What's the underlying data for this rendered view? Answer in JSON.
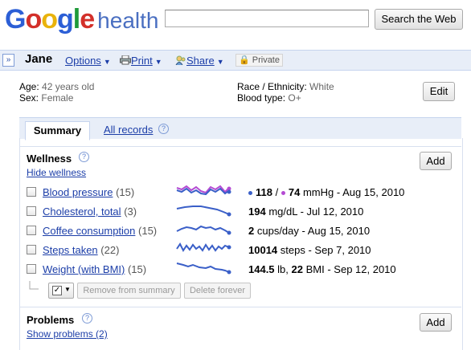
{
  "header": {
    "logo_text": "Google",
    "product": "health",
    "search_placeholder": "",
    "search_button": "Search the Web"
  },
  "profile": {
    "collapse_glyph": "»",
    "name": "Jane",
    "options": "Options",
    "print": "Print",
    "share": "Share",
    "private": "Private",
    "age_label": "Age:",
    "age_value": "42 years old",
    "sex_label": "Sex:",
    "sex_value": "Female",
    "race_label": "Race / Ethnicity:",
    "race_value": "White",
    "blood_label": "Blood type:",
    "blood_value": "O+",
    "edit": "Edit"
  },
  "tabs": {
    "summary": "Summary",
    "all_records": "All records"
  },
  "wellness": {
    "title": "Wellness",
    "hide": "Hide wellness",
    "add": "Add",
    "rows": [
      {
        "name": "Blood pressure",
        "count": "(15)",
        "value_a": "118",
        "sep": "/",
        "value_b": "74",
        "unit_date": "mmHg - Aug 15, 2010",
        "colors": [
          "#3a5fc8",
          "#b44bd3"
        ]
      },
      {
        "name": "Cholesterol, total",
        "count": "(3)",
        "value_a": "194",
        "unit_date": "mg/dL - Jul 12, 2010"
      },
      {
        "name": "Coffee consumption",
        "count": "(15)",
        "value_a": "2",
        "unit_date": "cups/day - Aug 15, 2010"
      },
      {
        "name": "Steps taken",
        "count": "(22)",
        "value_a": "10014",
        "unit_date": "steps - Sep 7, 2010"
      },
      {
        "name": "Weight (with BMI)",
        "count": "(15)",
        "value_a": "144.5",
        "unit_a": "lb,",
        "value_b": "22",
        "unit_date": "BMI - Sep 12, 2010"
      }
    ],
    "remove_btn": "Remove from summary",
    "delete_btn": "Delete forever"
  },
  "problems": {
    "title": "Problems",
    "show": "Show problems (2)",
    "add": "Add"
  },
  "colors": {
    "link": "#1c3ea8",
    "spark_blue": "#3a5fc8",
    "spark_purple": "#b44bd3",
    "bar": "#e8eef8"
  },
  "icons": [
    "collapse-icon",
    "print-icon",
    "share-icon",
    "lock-icon",
    "help-icon",
    "checkbox-icon",
    "chevron-down-icon"
  ]
}
